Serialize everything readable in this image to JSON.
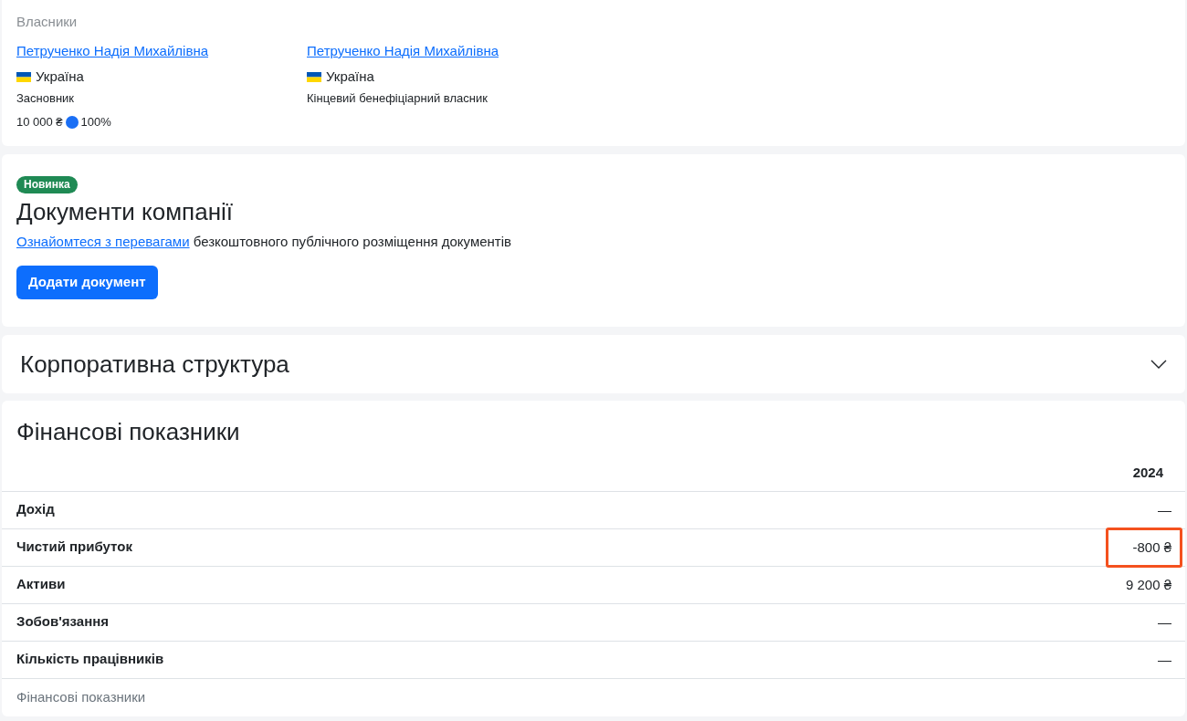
{
  "owners": {
    "title": "Власники",
    "items": [
      {
        "name": "Петрученко Надія Михайлівна",
        "country": "Україна",
        "role": "Засновник",
        "capital": "10 000 ₴",
        "share": "100%"
      },
      {
        "name": "Петрученко Надія Михайлівна",
        "country": "Україна",
        "role": "Кінцевий бенефіціарний власник"
      }
    ]
  },
  "documents": {
    "badge": "Новинка",
    "title": "Документи компанії",
    "link_text": "Ознайомтеся з перевагами",
    "description": "безкоштовного публічного розміщення документів",
    "button": "Додати документ"
  },
  "corporate_structure": {
    "title": "Корпоративна структура",
    "expanded": false
  },
  "financials": {
    "title": "Фінансові показники",
    "columns": [
      "2024"
    ],
    "rows": [
      {
        "label": "Дохід",
        "values": [
          "—"
        ],
        "highlighted": false
      },
      {
        "label": "Чистий прибуток",
        "values": [
          "-800 ₴"
        ],
        "highlighted": true
      },
      {
        "label": "Активи",
        "values": [
          "9 200 ₴"
        ],
        "highlighted": false
      },
      {
        "label": "Зобов'язання",
        "values": [
          "—"
        ],
        "highlighted": false
      },
      {
        "label": "Кількість працівників",
        "values": [
          "—"
        ],
        "highlighted": false
      }
    ],
    "caption": "Фінансові показники"
  }
}
